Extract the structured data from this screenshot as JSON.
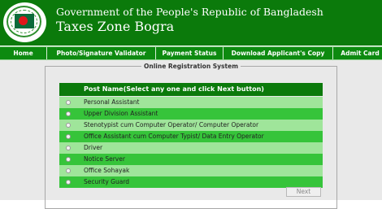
{
  "header": {
    "title_line1": "Government of the People's Republic of Bangladesh",
    "title_line2": "Taxes Zone Bogra"
  },
  "nav": {
    "items": [
      "Home",
      "Photo/Signature Validator",
      "Payment Status",
      "Download Applicant's Copy",
      "Admit Card"
    ]
  },
  "form": {
    "legend": "Online Registration System",
    "table_header": "Post Name(Select any one and click Next button)",
    "posts": [
      "Personal Assistant",
      "Upper Division Assistant",
      "Stenotypist cum Computer Operator/ Computer Operator",
      "Office Assistant cum Computer Typist/ Data Entry Operator",
      "Driver",
      "Notice Server",
      "Office Sohayak",
      "Security Guard"
    ],
    "next_label": "Next"
  },
  "colors": {
    "header_bg": "#0b7a0b",
    "row_light": "#9fe59a",
    "row_dark": "#36c43a"
  },
  "icons": {
    "logo": "bangladesh-emblem-icon",
    "radio": "radio-button-icon"
  }
}
